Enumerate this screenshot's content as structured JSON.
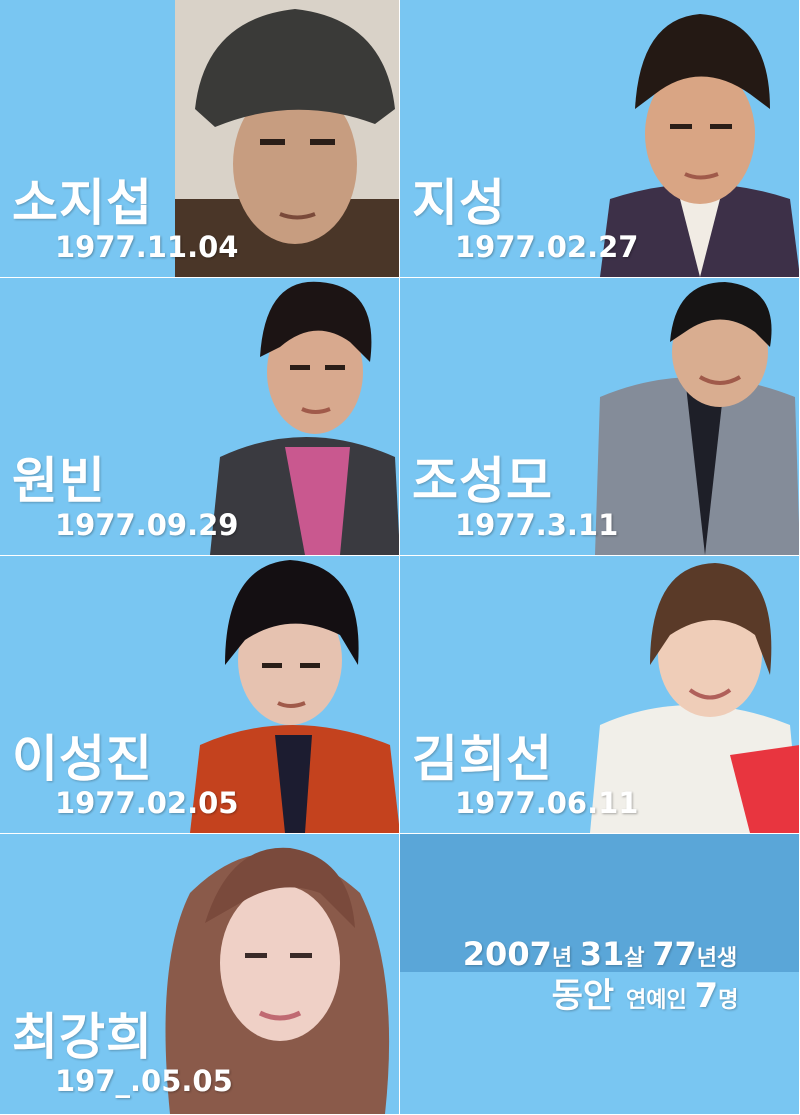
{
  "colors": {
    "background_blue": "#79c6f2",
    "band_blue": "#5aa6d8",
    "text": "#ffffff"
  },
  "people": [
    {
      "name": "소지섭",
      "birth": "1977.11.04",
      "photo": "man-with-newsboy-cap"
    },
    {
      "name": "지성",
      "birth": "1977.02.27",
      "photo": "man-in-suit"
    },
    {
      "name": "원빈",
      "birth": "1977.09.29",
      "photo": "man-in-pink-shirt"
    },
    {
      "name": "조성모",
      "birth": "1977.3.11",
      "photo": "man-in-grey-suit"
    },
    {
      "name": "이성진",
      "birth": "1977.02.05",
      "photo": "man-in-red-shirt"
    },
    {
      "name": "김희선",
      "birth": "1977.06.11",
      "photo": "woman-smiling"
    },
    {
      "name": "최강희",
      "birth": "197_.05.05",
      "photo": "woman-with-long-hair"
    }
  ],
  "summary": {
    "line1_a": "2007",
    "line1_b": "년 ",
    "line1_c": "31",
    "line1_d": "살 ",
    "line1_e": "77",
    "line1_f": "년생",
    "line2_a": "동안 ",
    "line2_b": "연예인 ",
    "line2_c": "7",
    "line2_d": "명"
  }
}
